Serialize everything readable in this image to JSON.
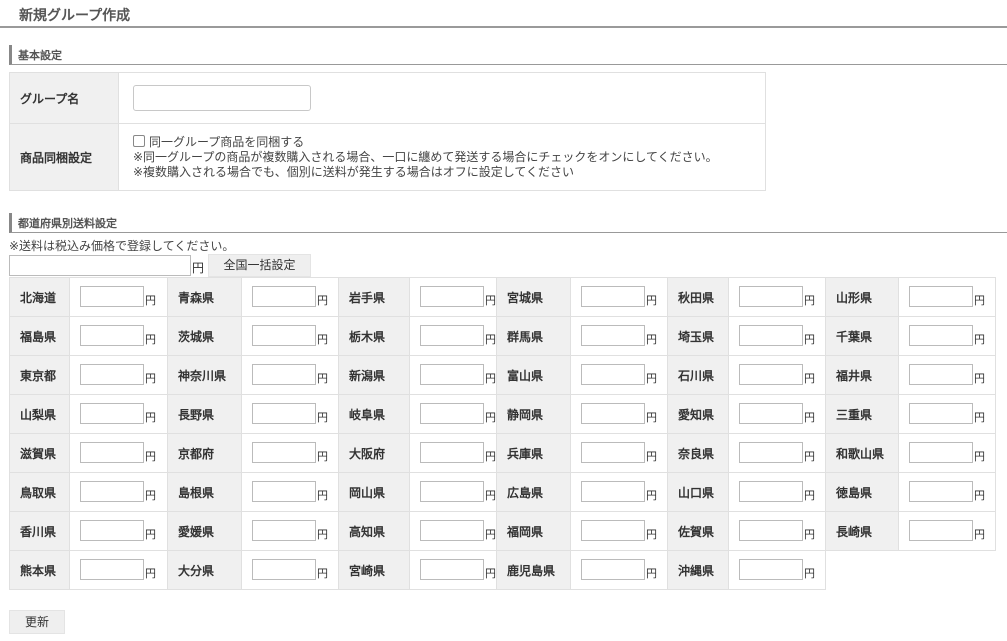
{
  "page_title": "新規グループ作成",
  "basic_section": {
    "title": "基本設定",
    "group_name_label": "グループ名",
    "group_name_value": "",
    "bundle_label": "商品同梱設定",
    "bundle_checkbox_label": "同一グループ商品を同梱する",
    "bundle_checked": false,
    "bundle_note_1": "※同一グループの商品が複数購入される場合、一口に纏めて発送する場合にチェックをオンにしてください。",
    "bundle_note_2": "※複数購入される場合でも、個別に送料が発生する場合はオフに設定してください"
  },
  "shipping_section": {
    "title": "都道府県別送料設定",
    "tax_note": "※送料は税込み価格で登録してください。",
    "bulk_value": "",
    "yen_unit": "円",
    "bulk_button_label": "全国一括設定"
  },
  "prefectures": [
    "北海道",
    "青森県",
    "岩手県",
    "宮城県",
    "秋田県",
    "山形県",
    "福島県",
    "茨城県",
    "栃木県",
    "群馬県",
    "埼玉県",
    "千葉県",
    "東京都",
    "神奈川県",
    "新潟県",
    "富山県",
    "石川県",
    "福井県",
    "山梨県",
    "長野県",
    "岐阜県",
    "静岡県",
    "愛知県",
    "三重県",
    "滋賀県",
    "京都府",
    "大阪府",
    "兵庫県",
    "奈良県",
    "和歌山県",
    "鳥取県",
    "島根県",
    "岡山県",
    "広島県",
    "山口県",
    "徳島県",
    "香川県",
    "愛媛県",
    "高知県",
    "福岡県",
    "佐賀県",
    "長崎県",
    "熊本県",
    "大分県",
    "宮崎県",
    "鹿児島県",
    "沖縄県"
  ],
  "update_button_label": "更新"
}
